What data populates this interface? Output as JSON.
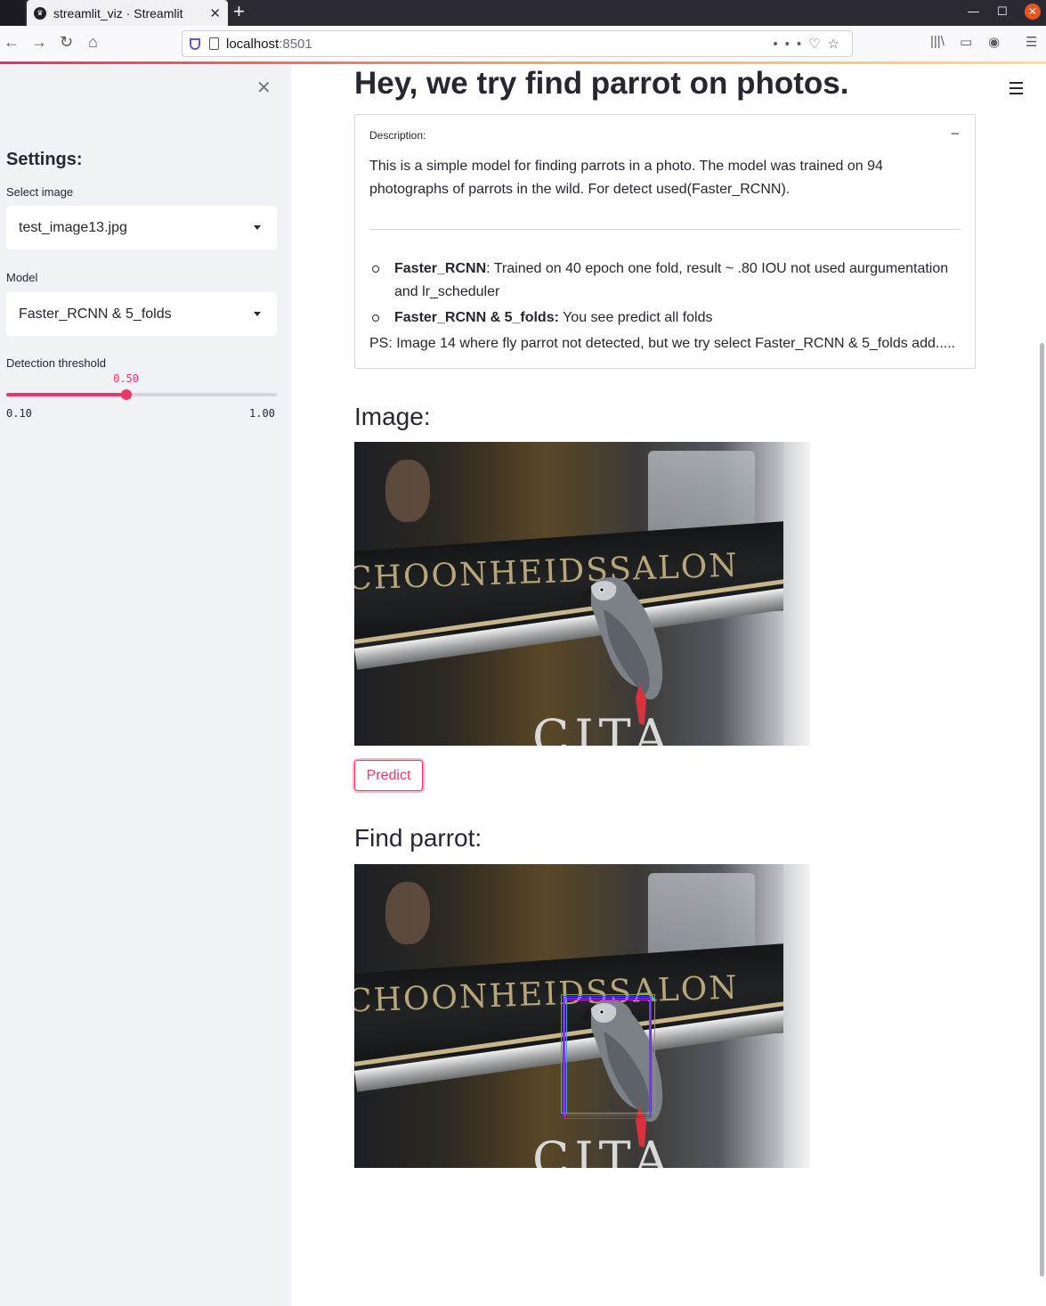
{
  "browser": {
    "tab_title": "streamlit_viz · Streamlit",
    "url_host": "localhost",
    "url_port": ":8501"
  },
  "sidebar": {
    "header": "Settings:",
    "select_image_label": "Select image",
    "select_image_value": "test_image13.jpg",
    "model_label": "Model",
    "model_value": "Faster_RCNN & 5_folds",
    "threshold_label": "Detection threshold",
    "threshold_value": "0.50",
    "threshold_min": "0.10",
    "threshold_max": "1.00",
    "threshold_fraction": 0.4444
  },
  "main": {
    "title": "Hey, we try find parrot on photos.",
    "expander": {
      "label": "Description:",
      "toggle": "–",
      "text": "This is a simple model for finding parrots in a photo. The model was trained on 94 photographs of parrots in the wild. For detect used(Faster_RCNN).",
      "items": [
        {
          "bold": "Faster_RCNN",
          "text": ": Trained on 40 epoch one fold, result ~ .80 IOU not used aurgumentation and lr_scheduler"
        },
        {
          "bold": "Faster_RCNN & 5_folds:",
          "text": " You see predict all folds"
        }
      ],
      "ps": "PS: Image 14 where fly parrot not detected, but we try select Faster_RCNN & 5_folds add....."
    },
    "image_header": "Image:",
    "predict_label": "Predict",
    "result_header": "Find parrot:",
    "photo_sign_text": "CHOONHEIDSSALON",
    "photo_bottom_text": "CITA",
    "bbox_colors": [
      "#3b3bff",
      "#c020c0",
      "#2aa8c8",
      "#8aa040",
      "#7a3cff"
    ]
  }
}
